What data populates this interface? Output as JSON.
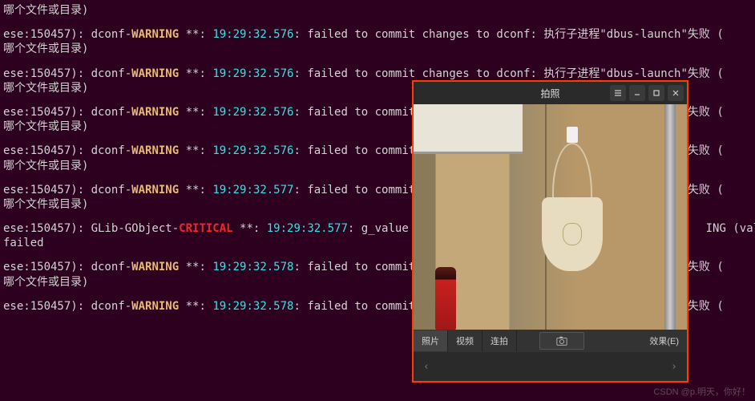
{
  "terminal": {
    "lines": [
      [
        {
          "c": "txt",
          "t": "哪个文件或目录)"
        }
      ],
      [
        {
          "c": "txt",
          "t": "ese:150457): dconf-"
        },
        {
          "c": "warn",
          "t": "WARNING"
        },
        {
          "c": "txt",
          "t": " **: "
        },
        {
          "c": "ts",
          "t": "19:29:32.576"
        },
        {
          "c": "txt",
          "t": ": failed to commit changes to dconf: 执行子进程\"dbus-launch\"失败 ("
        }
      ],
      [
        {
          "c": "txt",
          "t": "哪个文件或目录)"
        }
      ],
      [
        {
          "c": "txt",
          "t": "ese:150457): dconf-"
        },
        {
          "c": "warn",
          "t": "WARNING"
        },
        {
          "c": "txt",
          "t": " **: "
        },
        {
          "c": "ts",
          "t": "19:29:32.576"
        },
        {
          "c": "txt",
          "t": ": failed to commit changes to dconf: 执行子进程\"dbus-launch\"失败 ("
        }
      ],
      [
        {
          "c": "txt",
          "t": "哪个文件或目录)"
        }
      ],
      [
        {
          "c": "txt",
          "t": "ese:150457): dconf-"
        },
        {
          "c": "warn",
          "t": "WARNING"
        },
        {
          "c": "txt",
          "t": " **: "
        },
        {
          "c": "ts",
          "t": "19:29:32.576"
        },
        {
          "c": "txt",
          "t": ": failed to commit changes to dconf: 执行子进程\"dbus-launch\"失败 ("
        }
      ],
      [
        {
          "c": "txt",
          "t": "哪个文件或目录)"
        }
      ],
      [
        {
          "c": "txt",
          "t": "ese:150457): dconf-"
        },
        {
          "c": "warn",
          "t": "WARNING"
        },
        {
          "c": "txt",
          "t": " **: "
        },
        {
          "c": "ts",
          "t": "19:29:32.576"
        },
        {
          "c": "txt",
          "t": ": failed to commit changes to dconf: 执行子进程\"dbus-launch\"失败 ("
        }
      ],
      [
        {
          "c": "txt",
          "t": "哪个文件或目录)"
        }
      ],
      [
        {
          "c": "txt",
          "t": "ese:150457): dconf-"
        },
        {
          "c": "warn",
          "t": "WARNING"
        },
        {
          "c": "txt",
          "t": " **: "
        },
        {
          "c": "ts",
          "t": "19:29:32.577"
        },
        {
          "c": "txt",
          "t": ": failed to commit changes to dconf: 执行子进程\"dbus-launch\"失败 ("
        }
      ],
      [
        {
          "c": "txt",
          "t": "哪个文件或目录)"
        }
      ],
      [
        {
          "c": "txt",
          "t": "ese:150457): GLib-GObject-"
        },
        {
          "c": "crit",
          "t": "CRITICAL"
        },
        {
          "c": "txt",
          "t": " **: "
        },
        {
          "c": "ts",
          "t": "19:29:32.577"
        },
        {
          "c": "txt",
          "t": ": g_value                                            ING (valu"
        }
      ],
      [
        {
          "c": "txt",
          "t": "failed"
        }
      ],
      [
        {
          "c": "txt",
          "t": "ese:150457): dconf-"
        },
        {
          "c": "warn",
          "t": "WARNING"
        },
        {
          "c": "txt",
          "t": " **: "
        },
        {
          "c": "ts",
          "t": "19:29:32.578"
        },
        {
          "c": "txt",
          "t": ": failed to commit changes to dconf: 执行子进程\"dbus-launch\"失败 ("
        }
      ],
      [
        {
          "c": "txt",
          "t": "哪个文件或目录)"
        }
      ],
      [
        {
          "c": "txt",
          "t": "ese:150457): dconf-"
        },
        {
          "c": "warn",
          "t": "WARNING"
        },
        {
          "c": "txt",
          "t": " **: "
        },
        {
          "c": "ts",
          "t": "19:29:32.578"
        },
        {
          "c": "txt",
          "t": ": failed to commit changes to dconf: 执行子进程\"dbus-launch\"失败 ("
        }
      ]
    ]
  },
  "cheese": {
    "title": "拍照",
    "tabs": {
      "photo": "照片",
      "video": "视频",
      "burst": "连拍"
    },
    "effects": "效果(E)",
    "nav_prev": "‹",
    "nav_next": "›"
  },
  "watermark": "CSDN @p.明天，你好！"
}
